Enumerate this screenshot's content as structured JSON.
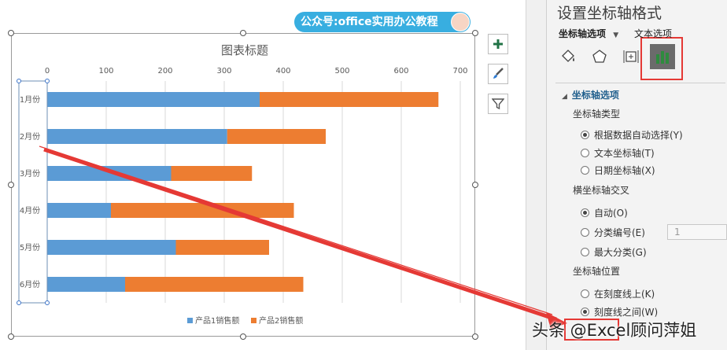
{
  "watermark": "公众号:office实用办公教程",
  "bottom_watermark": "头条 @Excel顾问萍姐",
  "chart": {
    "title": "图表标题",
    "x_ticks": [
      "0",
      "100",
      "200",
      "300",
      "400",
      "500",
      "600",
      "700"
    ],
    "categories": [
      "1月份",
      "2月份",
      "3月份",
      "4月份",
      "5月份",
      "6月份"
    ],
    "legend": [
      "产品1销售额",
      "产品2销售额"
    ]
  },
  "chart_data": {
    "type": "bar",
    "orientation": "horizontal",
    "stacked": true,
    "title": "图表标题",
    "categories": [
      "1月份",
      "2月份",
      "3月份",
      "4月份",
      "5月份",
      "6月份"
    ],
    "series": [
      {
        "name": "产品1销售额",
        "values": [
          360,
          305,
          210,
          108,
          218,
          132
        ],
        "color": "#5b9bd5"
      },
      {
        "name": "产品2销售额",
        "values": [
          303,
          167,
          137,
          310,
          158,
          302
        ],
        "color": "#ed7d31"
      }
    ],
    "xlim": [
      0,
      700
    ],
    "xticks": [
      0,
      100,
      200,
      300,
      400,
      500,
      600,
      700
    ],
    "grid": true,
    "legend_position": "bottom",
    "xaxis_position": "top"
  },
  "pane": {
    "title": "设置坐标轴格式",
    "tab_axis_options": "坐标轴选项",
    "tab_text_options": "文本选项",
    "section": "坐标轴选项",
    "axis_type": {
      "label": "坐标轴类型",
      "options": [
        "根据数据自动选择(Y)",
        "文本坐标轴(T)",
        "日期坐标轴(X)"
      ]
    },
    "cross": {
      "label": "横坐标轴交叉",
      "options": [
        "自动(O)",
        "分类编号(E)",
        "最大分类(G)"
      ],
      "number": "1"
    },
    "position": {
      "label": "坐标轴位置",
      "options": [
        "在刻度线上(K)",
        "刻度线之间(W)"
      ]
    }
  },
  "colors": {
    "series1": "#5b9bd5",
    "series2": "#ed7d31",
    "highlight": "#e53935",
    "accent": "#217346"
  }
}
